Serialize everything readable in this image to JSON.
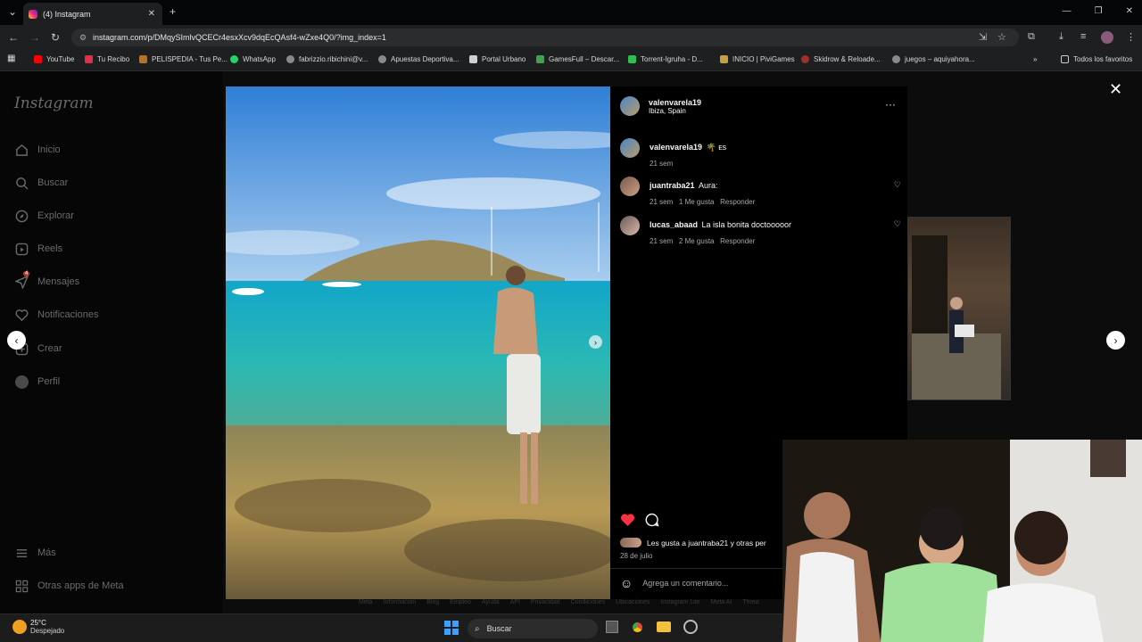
{
  "browser": {
    "tab_title": "(4) Instagram",
    "url": "instagram.com/p/DMqySImlvQCECr4esxXcv9dqEcQAsf4-wZxe4Q0/?img_index=1",
    "bookmarks": [
      {
        "label": "YouTube",
        "color": "#ff0000"
      },
      {
        "label": "Tu Recibo",
        "color": "#e0304a"
      },
      {
        "label": "PELISPEDIA - Tus Pe...",
        "color": "#b0742c"
      },
      {
        "label": "WhatsApp",
        "color": "#25d366"
      },
      {
        "label": "fabrizzio.ribichini@v...",
        "color": "#8a8a8a"
      },
      {
        "label": "Apuestas Deportiva...",
        "color": "#8a8a8a"
      },
      {
        "label": "Portal Urbano",
        "color": "#d0d0d0"
      },
      {
        "label": "GamesFull – Descar...",
        "color": "#3fa34d"
      },
      {
        "label": "Torrent-Igruha - D...",
        "color": "#2fbf4f"
      },
      {
        "label": "INICIO | PiviGames",
        "color": "#c8a040"
      },
      {
        "label": "Skidrow & Reloade...",
        "color": "#a03030"
      },
      {
        "label": "juegos – aquiyahora...",
        "color": "#8a8a8a"
      }
    ],
    "all_bookmarks": "Todos los favoritos"
  },
  "sidebar": {
    "logo": "Instagram",
    "items": [
      {
        "label": "Inicio",
        "icon": "home-icon"
      },
      {
        "label": "Buscar",
        "icon": "search-icon"
      },
      {
        "label": "Explorar",
        "icon": "compass-icon"
      },
      {
        "label": "Reels",
        "icon": "reels-icon"
      },
      {
        "label": "Mensajes",
        "icon": "messages-icon",
        "badge": "4"
      },
      {
        "label": "Notificaciones",
        "icon": "heart-icon"
      },
      {
        "label": "Crear",
        "icon": "plus-icon"
      },
      {
        "label": "Perfil",
        "icon": "avatar"
      }
    ],
    "more": "Más",
    "meta_apps": "Otras apps de Meta"
  },
  "post": {
    "author": "valenvarela19",
    "location": "Ibiza, Spain",
    "caption_user": "valenvarela19",
    "caption_text": "🌴 ᴇs",
    "caption_time": "21 sem",
    "comments": [
      {
        "user": "juantraba21",
        "text": "Aura:",
        "time": "21 sem",
        "likes": "1 Me gusta",
        "reply": "Responder"
      },
      {
        "user": "lucas_abaad",
        "text": "La isla bonita doctooooor",
        "time": "21 sem",
        "likes": "2 Me gusta",
        "reply": "Responder"
      }
    ],
    "liked_by": "Les gusta a juantraba21 y otras per",
    "date": "28 de julio",
    "comment_placeholder": "Agrega un comentario..."
  },
  "footer_links": [
    "Meta",
    "Información",
    "Blog",
    "Empleo",
    "Ayuda",
    "API",
    "Privacidad",
    "Condiciones",
    "Ubicaciones",
    "Instagram Lite",
    "Meta AI",
    "Threa"
  ],
  "taskbar": {
    "weather_temp": "25°C",
    "weather_desc": "Despejado",
    "search": "Buscar"
  },
  "colors": {
    "like": "#ff3040",
    "background": "#0c0c0c"
  }
}
